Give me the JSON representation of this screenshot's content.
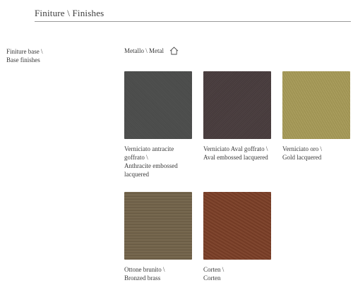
{
  "header": {
    "title": "Finiture \\ Finishes"
  },
  "section": {
    "label_line1": "Finiture base \\",
    "label_line2": "Base finishes"
  },
  "material": {
    "label": "Metallo \\ Metal",
    "icon": "home-icon"
  },
  "swatches": [
    {
      "color": "#4a4b4a",
      "lines": [
        "Verniciato antracite",
        "goffrato \\",
        "Anthracite embossed",
        "lacquered"
      ]
    },
    {
      "color": "#473b3c",
      "lines": [
        "Verniciato Aval goffrato \\",
        "Aval embossed lacquered"
      ]
    },
    {
      "color": "#a79a57",
      "lines": [
        "Verniciato oro \\",
        "Gold lacquered"
      ]
    },
    {
      "color": "#6f6046",
      "lines": [
        "Ottone brunito \\",
        "Bronzed brass"
      ]
    },
    {
      "color": "#7b3f27",
      "lines": [
        "Corten \\",
        "Corten"
      ]
    }
  ]
}
